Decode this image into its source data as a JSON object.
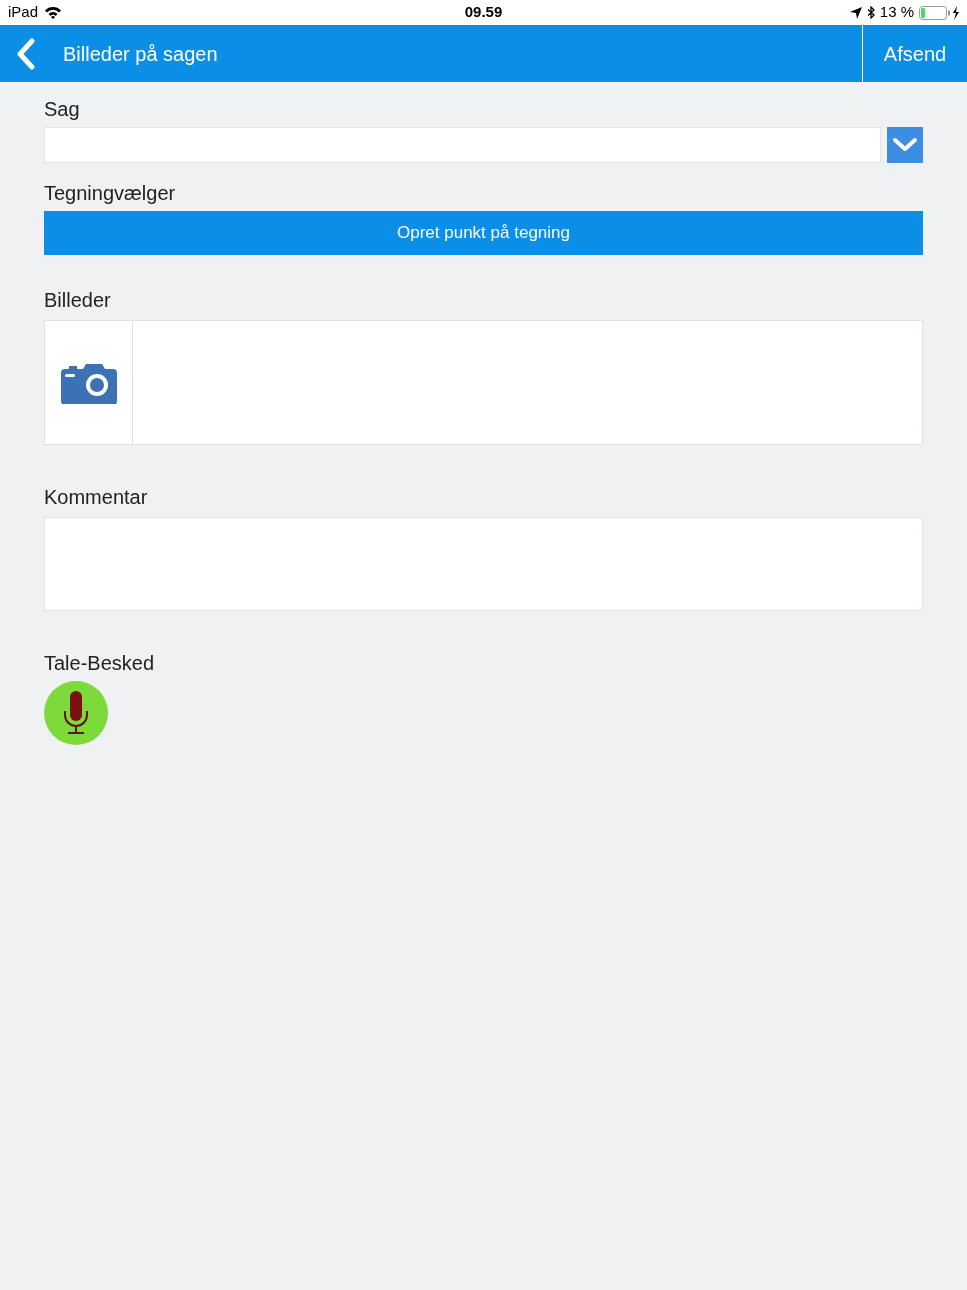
{
  "status_bar": {
    "device": "iPad",
    "time": "09.59",
    "battery_text": "13 %"
  },
  "header": {
    "title": "Billeder på sagen",
    "action": "Afsend"
  },
  "fields": [
    {
      "kind": "select",
      "label": "Sag"
    },
    {
      "kind": "button",
      "label": "Tegningvælger",
      "button": "Opret punkt på tegning"
    },
    {
      "kind": "photos",
      "label": "Billeder"
    },
    {
      "kind": "textarea",
      "label": "Kommentar"
    },
    {
      "kind": "voice",
      "label": "Tale-Besked"
    }
  ]
}
